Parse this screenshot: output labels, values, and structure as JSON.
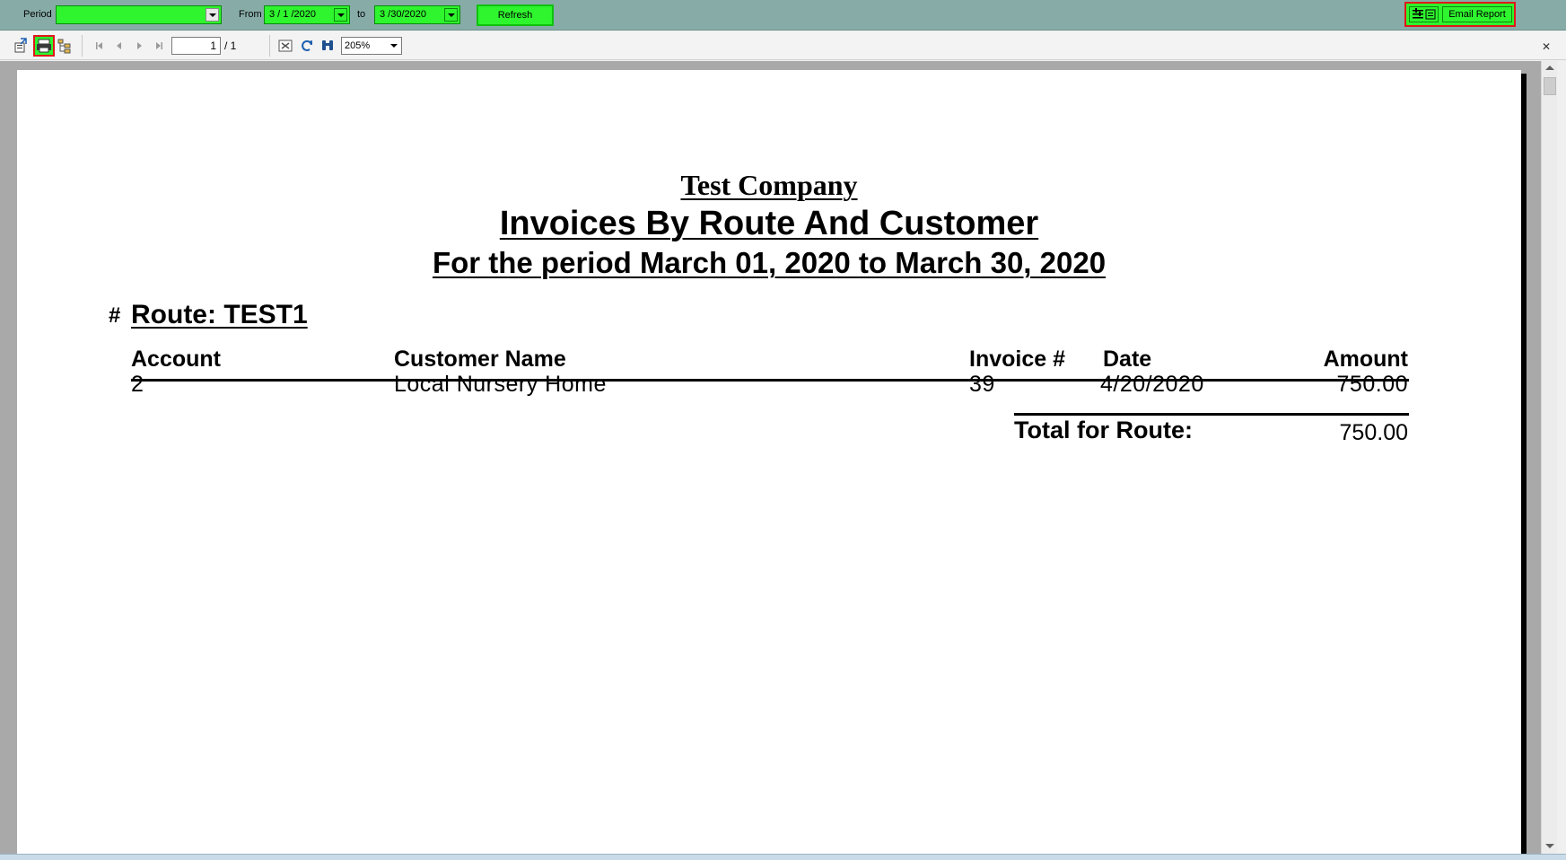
{
  "filter_bar": {
    "period_label": "Period",
    "period_value": "",
    "from_label": "From",
    "from_value": "3 / 1 /2020",
    "to_label": "to",
    "to_value": "3 /30/2020",
    "refresh_label": "Refresh",
    "email_label": "Email Report"
  },
  "viewer_toolbar": {
    "icons": [
      "export-icon",
      "print-icon",
      "group-tree-icon",
      "first-page-icon",
      "prev-page-icon",
      "next-page-icon",
      "last-page-icon",
      "stop-icon",
      "refresh-icon",
      "search-icon"
    ],
    "page_current": "1",
    "page_total": "/ 1",
    "zoom": "205%"
  },
  "report": {
    "company": "Test Company",
    "title": "Invoices By Route And Customer",
    "period": "For the period March 01, 2020 to March 30, 2020",
    "hash": "#",
    "route_heading": "Route: TEST1",
    "columns": {
      "account": "Account",
      "customer_name": "Customer Name",
      "invoice": "Invoice #",
      "date": "Date",
      "amount": "Amount"
    },
    "rows": [
      {
        "account": "2",
        "customer_name": "Local Nursery Home",
        "invoice": "39",
        "date": "4/20/2020",
        "amount": "750.00"
      }
    ],
    "total_label": "Total for Route:",
    "total_value": "750.00"
  },
  "colors": {
    "filter_bar_bg": "#87aca8",
    "control_green": "#2ef52e",
    "highlight_red": "#e01818"
  }
}
